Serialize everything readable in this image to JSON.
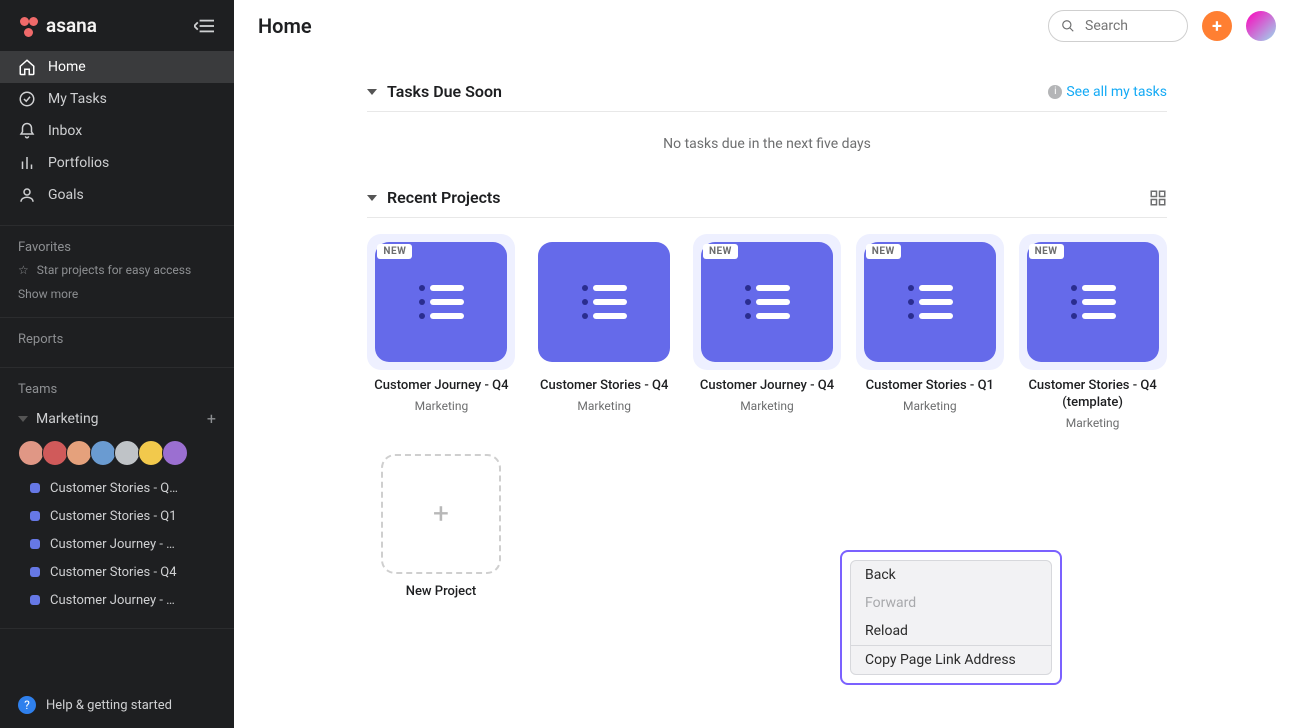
{
  "brand": {
    "name": "asana"
  },
  "page_title": "Home",
  "search": {
    "placeholder": "Search"
  },
  "sidebar": {
    "nav": [
      {
        "label": "Home",
        "icon": "home-icon",
        "active": true
      },
      {
        "label": "My Tasks",
        "icon": "check-circle-icon",
        "active": false
      },
      {
        "label": "Inbox",
        "icon": "bell-icon",
        "active": false
      },
      {
        "label": "Portfolios",
        "icon": "bars-icon",
        "active": false
      },
      {
        "label": "Goals",
        "icon": "person-icon",
        "active": false
      }
    ],
    "favorites": {
      "header": "Favorites",
      "empty_hint": "Star projects for easy access",
      "show_more": "Show more"
    },
    "reports": {
      "header": "Reports"
    },
    "teams": {
      "header": "Teams",
      "team_name": "Marketing",
      "avatars_count": 7,
      "projects": [
        {
          "label": "Customer Stories - Q…"
        },
        {
          "label": "Customer Stories - Q1"
        },
        {
          "label": "Customer Journey - …"
        },
        {
          "label": "Customer Stories - Q4"
        },
        {
          "label": "Customer Journey - …"
        }
      ]
    },
    "help": "Help & getting started"
  },
  "tasks_due": {
    "title": "Tasks Due Soon",
    "see_all": "See all my tasks",
    "empty": "No tasks due in the next five days"
  },
  "recent_projects": {
    "title": "Recent Projects",
    "new_badge": "NEW",
    "new_project_label": "New Project",
    "items": [
      {
        "title": "Customer Journey - Q4",
        "team": "Marketing",
        "is_new": true
      },
      {
        "title": "Customer Stories - Q4",
        "team": "Marketing",
        "is_new": false
      },
      {
        "title": "Customer Journey - Q4",
        "team": "Marketing",
        "is_new": true
      },
      {
        "title": "Customer Stories - Q1",
        "team": "Marketing",
        "is_new": true
      },
      {
        "title": "Customer Stories - Q4 (template)",
        "team": "Marketing",
        "is_new": true
      }
    ]
  },
  "context_menu": {
    "items": [
      {
        "label": "Back",
        "enabled": true
      },
      {
        "label": "Forward",
        "enabled": false
      },
      {
        "label": "Reload",
        "enabled": true
      }
    ],
    "items2": [
      {
        "label": "Copy Page Link Address",
        "enabled": true
      }
    ]
  },
  "avatar_colors": [
    "#e09785",
    "#d05a5a",
    "#e5a17c",
    "#6a9bd1",
    "#bfc3c7",
    "#f2c94c",
    "#9b6fd1"
  ]
}
